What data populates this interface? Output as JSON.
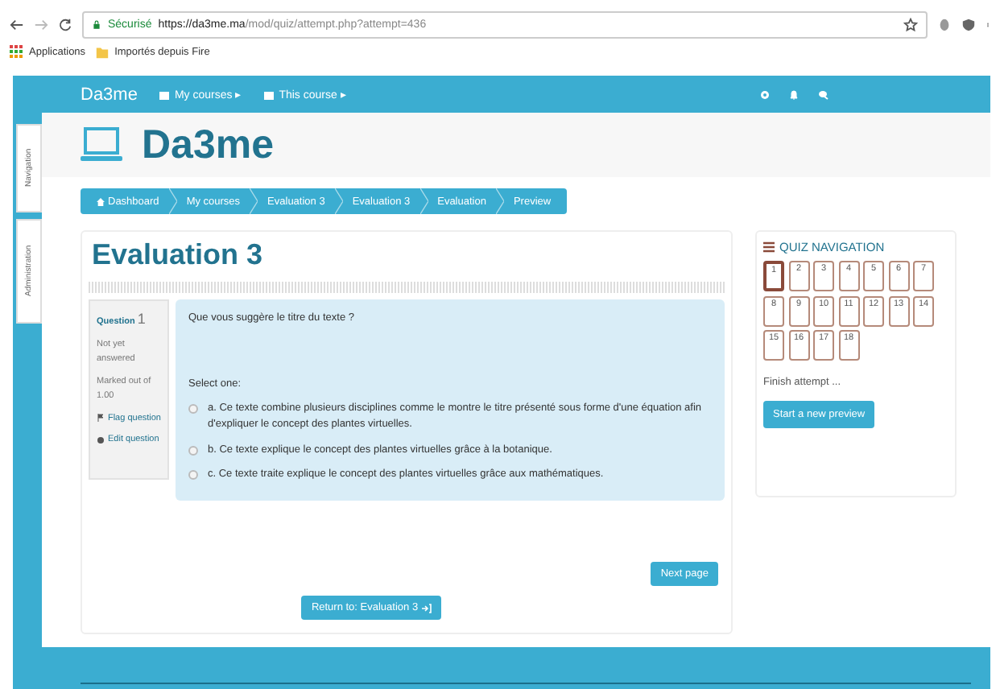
{
  "browser": {
    "secure_label": "Sécurisé",
    "url_host": "https://da3me.ma",
    "url_path": "/mod/quiz/attempt.php?attempt=436",
    "bookmarks": [
      "Applications",
      "Importés depuis Fire"
    ]
  },
  "side_tabs": [
    "Navigation",
    "Administration"
  ],
  "navbar": {
    "brand": "Da3me",
    "menus": [
      "My courses ▸",
      "This course ▸"
    ]
  },
  "site_title": "Da3me",
  "breadcrumb": [
    "Dashboard",
    "My courses",
    "Evaluation 3",
    "Evaluation 3",
    "Evaluation",
    "Preview"
  ],
  "page_title": "Evaluation 3",
  "question": {
    "label": "Question",
    "number": "1",
    "status": "Not yet answered",
    "marked": "Marked out of 1.00",
    "flag": "Flag question",
    "edit": "Edit question",
    "text": "Que vous suggère le titre du texte ?",
    "prompt": "Select one:",
    "options": [
      {
        "text": "a. Ce texte combine plusieurs disciplines comme le montre le titre présenté sous forme d'une équation afin d'expliquer le concept des plantes virtuelles.",
        "checked": false
      },
      {
        "text": "b. Ce texte explique le concept des plantes virtuelles grâce à la botanique.",
        "checked": false
      },
      {
        "text": "c. Ce texte traite explique le concept des plantes virtuelles grâce aux mathématiques.",
        "checked": false
      }
    ]
  },
  "next_button": "Next page",
  "return_button": "Return to: Evaluation 3",
  "quiz_nav": {
    "title": "QUIZ NAVIGATION",
    "questions": [
      {
        "label": "1",
        "selected": true
      },
      {
        "label": "2",
        "selected": false
      },
      {
        "label": "3",
        "selected": false
      },
      {
        "label": "4",
        "selected": false
      },
      {
        "label": "5",
        "selected": false
      },
      {
        "label": "6",
        "selected": false
      },
      {
        "label": "7",
        "selected": false
      },
      {
        "label": "8",
        "selected": false
      },
      {
        "label": "9",
        "selected": false
      },
      {
        "label": "10",
        "selected": false
      },
      {
        "label": "11",
        "selected": false
      },
      {
        "label": "12",
        "selected": false
      },
      {
        "label": "13",
        "selected": false
      },
      {
        "label": "14",
        "selected": false
      },
      {
        "label": "15",
        "selected": false
      },
      {
        "label": "16",
        "selected": false
      },
      {
        "label": "17",
        "selected": false
      },
      {
        "label": "18",
        "selected": false
      }
    ],
    "finish": "Finish attempt ...",
    "new_preview": "Start a new preview"
  }
}
